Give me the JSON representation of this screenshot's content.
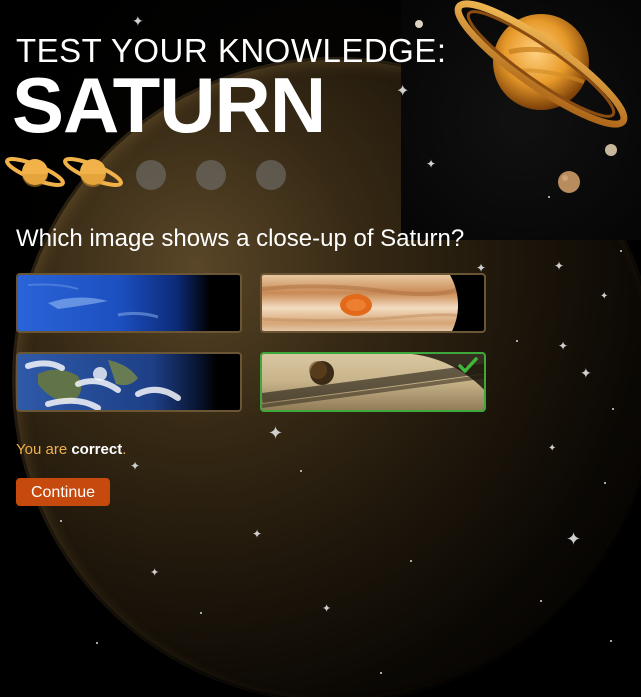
{
  "header": {
    "title_small": "TEST YOUR KNOWLEDGE:",
    "title_big": "SATURN"
  },
  "progress": {
    "answered": 2,
    "total": 5
  },
  "question": {
    "text": "Which image shows a close-up of Saturn?"
  },
  "options": [
    {
      "id": "neptune",
      "selected": false,
      "correct": false
    },
    {
      "id": "jupiter",
      "selected": false,
      "correct": false
    },
    {
      "id": "earth",
      "selected": false,
      "correct": false
    },
    {
      "id": "saturn",
      "selected": true,
      "correct": true
    }
  ],
  "feedback": {
    "prefix": "You are ",
    "result": "correct",
    "suffix": "."
  },
  "continue_label": "Continue",
  "colors": {
    "accent": "#c64a0d",
    "correct_border": "#3fa83a",
    "option_border": "#6a5535",
    "feedback": "#f0b04a",
    "progress_active": "#f2b24a"
  }
}
